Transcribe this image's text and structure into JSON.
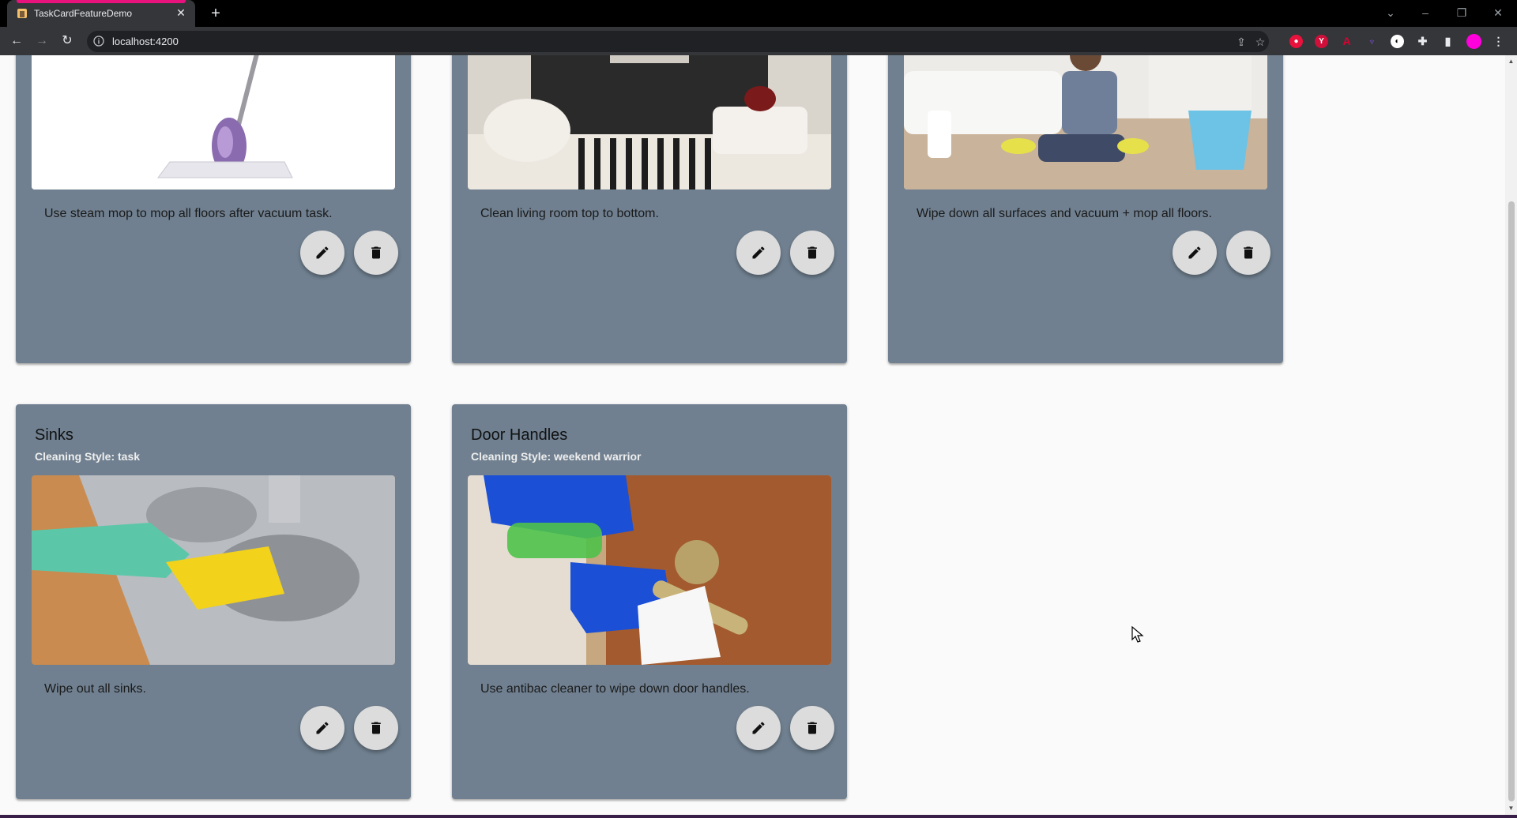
{
  "browser": {
    "tab_title": "TaskCardFeatureDemo",
    "url": "localhost:4200",
    "accent_color": "#e8127c"
  },
  "colors": {
    "card_background": "#708090",
    "fab_background": "#dcdcdc"
  },
  "cards": [
    {
      "title": "",
      "subtitle": "",
      "image": "steam-mop-image",
      "description": "Use steam mop to mop all floors after vacuum task.",
      "edit_icon": "pencil-icon",
      "delete_icon": "trash-icon"
    },
    {
      "title": "",
      "subtitle": "",
      "image": "living-room-image",
      "description": "Clean living room top to bottom.",
      "edit_icon": "pencil-icon",
      "delete_icon": "trash-icon"
    },
    {
      "title": "",
      "subtitle": "",
      "image": "floor-cleaning-image",
      "description": "Wipe down all surfaces and vacuum + mop all floors.",
      "edit_icon": "pencil-icon",
      "delete_icon": "trash-icon"
    },
    {
      "title": "Sinks",
      "subtitle": "Cleaning Style: task",
      "image": "sink-cleaning-image",
      "description": "Wipe out all sinks.",
      "edit_icon": "pencil-icon",
      "delete_icon": "trash-icon"
    },
    {
      "title": "Door Handles",
      "subtitle": "Cleaning Style: weekend warrior",
      "image": "door-handle-image",
      "description": "Use antibac cleaner to wipe down door handles.",
      "edit_icon": "pencil-icon",
      "delete_icon": "trash-icon"
    }
  ]
}
